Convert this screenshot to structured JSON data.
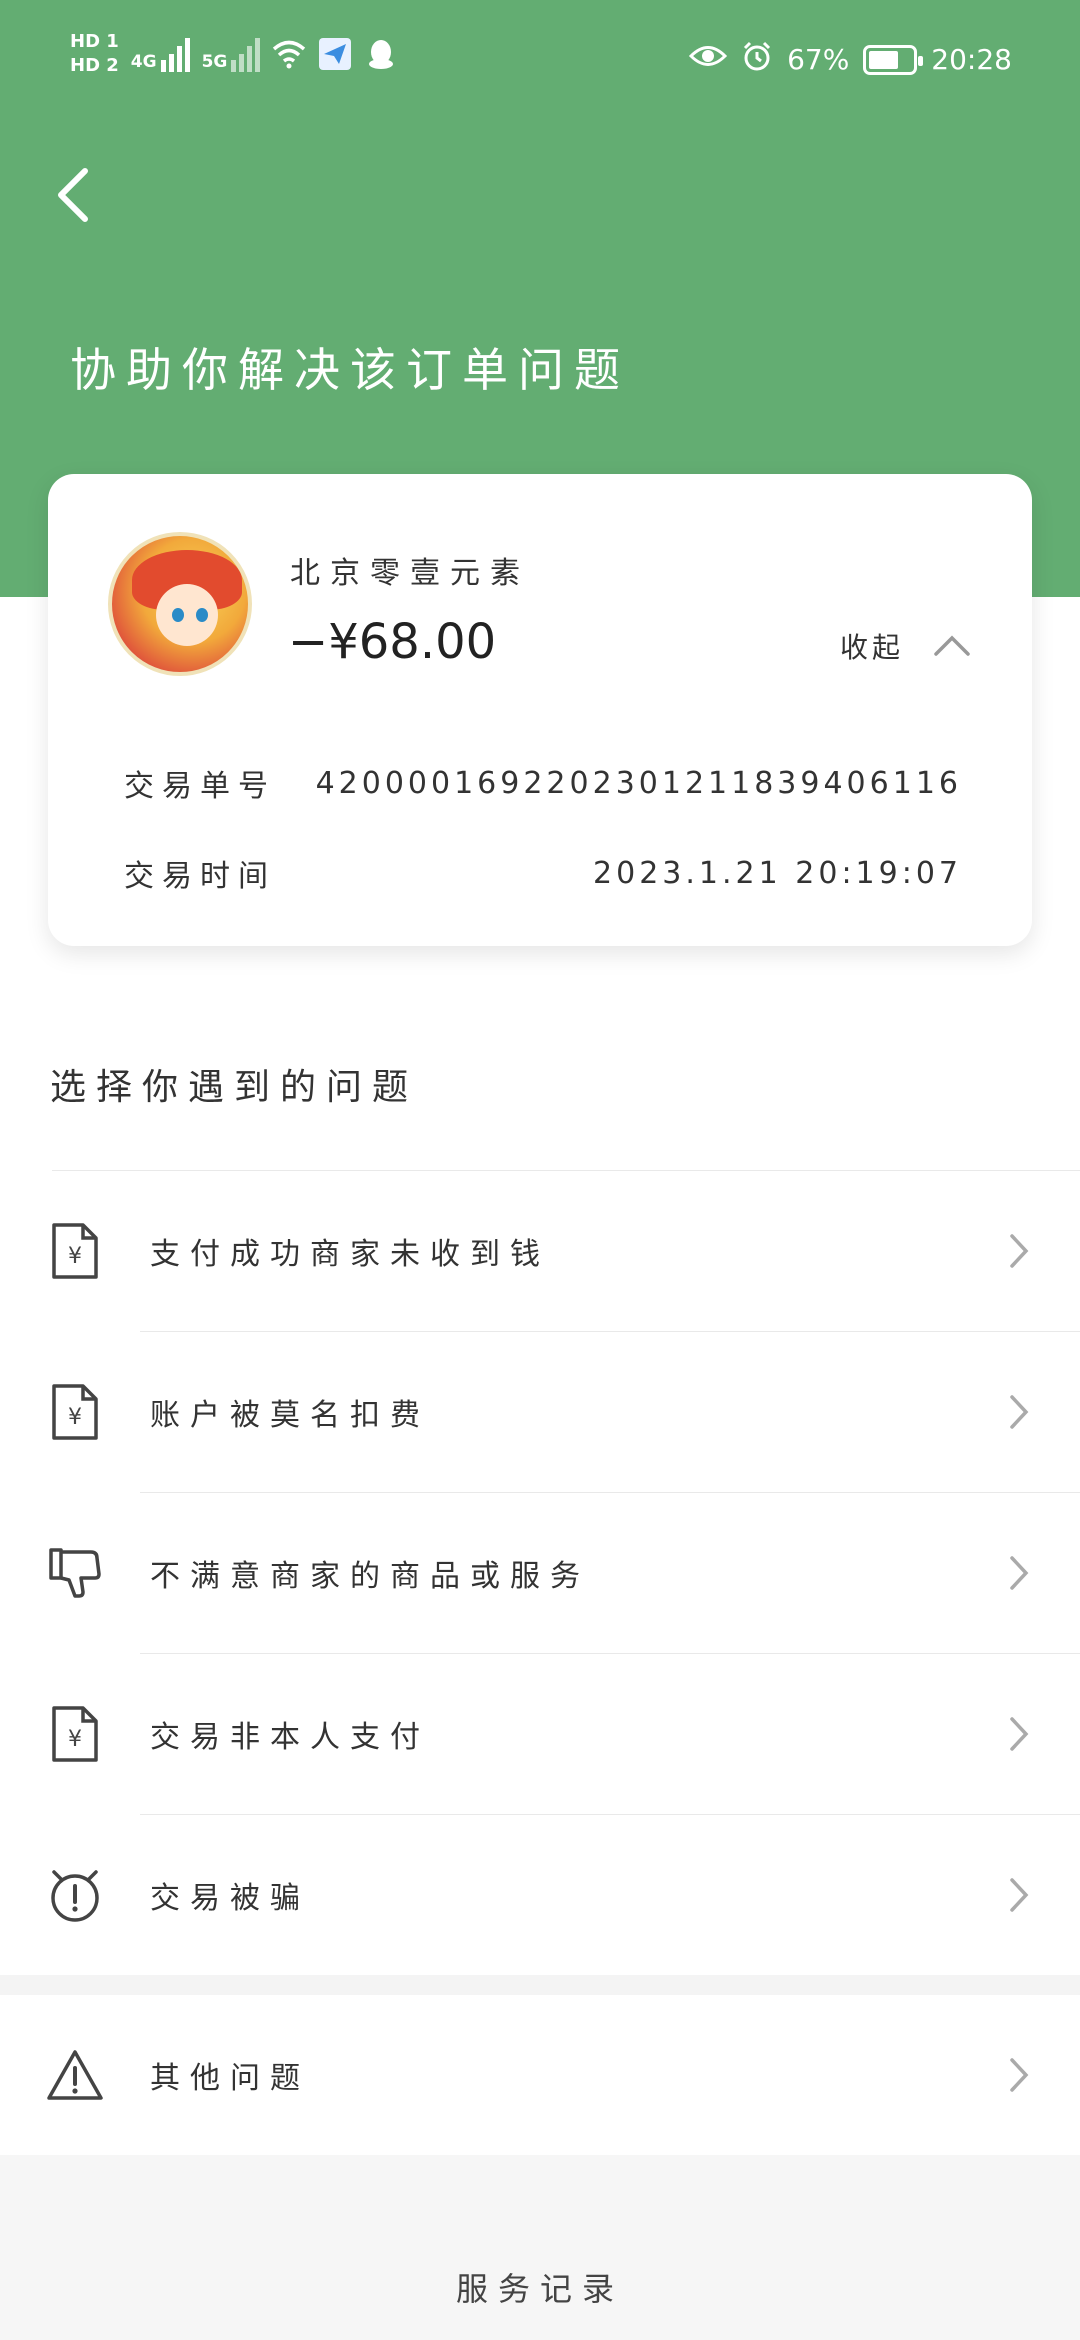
{
  "status_bar": {
    "hd1": "HD 1",
    "hd2": "HD 2",
    "net1": "4G",
    "net2": "5G",
    "battery_percent": "67%",
    "time": "20:28"
  },
  "header": {
    "title": "协助你解决该订单问题"
  },
  "order": {
    "merchant": "北京零壹元素",
    "amount": "−¥68.00",
    "collapse_label": "收起",
    "details": [
      {
        "label": "交易单号",
        "value": "4200001692202301211839406116"
      },
      {
        "label": "交易时间",
        "value": "2023.1.21 20:19:07"
      }
    ]
  },
  "issues": {
    "section_title": "选择你遇到的问题",
    "items": [
      {
        "label": "支付成功商家未收到钱",
        "icon": "receipt-yen-icon"
      },
      {
        "label": "账户被莫名扣费",
        "icon": "receipt-yen-icon"
      },
      {
        "label": "不满意商家的商品或服务",
        "icon": "thumbs-down-icon"
      },
      {
        "label": "交易非本人支付",
        "icon": "receipt-yen-icon"
      },
      {
        "label": "交易被骗",
        "icon": "alert-circle-icon"
      }
    ],
    "other": {
      "label": "其他问题",
      "icon": "warning-triangle-icon"
    }
  },
  "footer": {
    "service_record": "服务记录"
  },
  "colors": {
    "header_green": "#63ad72",
    "page_bg": "#f6f6f6",
    "card_bg": "#ffffff"
  }
}
